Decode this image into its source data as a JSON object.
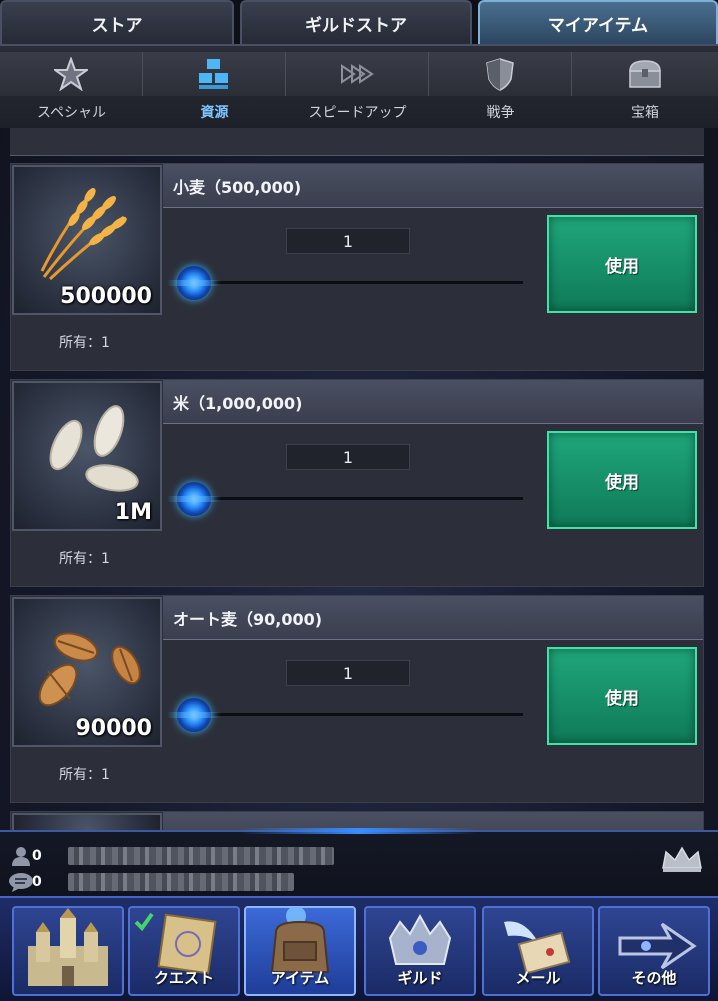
{
  "top_tabs": [
    {
      "label": "ストア"
    },
    {
      "label": "ギルドストア"
    },
    {
      "label": "マイアイテム"
    }
  ],
  "categories": [
    {
      "label": "スペシャル",
      "icon": "star-icon"
    },
    {
      "label": "資源",
      "icon": "boxes-icon"
    },
    {
      "label": "スピードアップ",
      "icon": "fast-forward-icon"
    },
    {
      "label": "戦争",
      "icon": "shield-icon"
    },
    {
      "label": "宝箱",
      "icon": "chest-icon"
    }
  ],
  "items": [
    {
      "name": "小麦（500,000)",
      "amount": "500000",
      "owned": "所有：1",
      "quantity": "1",
      "use_label": "使用",
      "icon": "wheat-icon"
    },
    {
      "name": "米（1,000,000)",
      "amount": "1M",
      "owned": "所有：1",
      "quantity": "1",
      "use_label": "使用",
      "icon": "rice-icon"
    },
    {
      "name": "オート麦（90,000)",
      "amount": "90000",
      "owned": "所有：1",
      "quantity": "1",
      "use_label": "使用",
      "icon": "oat-icon"
    }
  ],
  "status": {
    "members_count": "0",
    "messages_count": "0"
  },
  "nav": [
    {
      "label": "",
      "icon": "castle-icon"
    },
    {
      "label": "クエスト",
      "icon": "scroll-icon"
    },
    {
      "label": "アイテム",
      "icon": "backpack-icon"
    },
    {
      "label": "ギルド",
      "icon": "guild-crest-icon"
    },
    {
      "label": "メール",
      "icon": "winged-letter-icon"
    },
    {
      "label": "その他",
      "icon": "arrow-icon"
    }
  ]
}
